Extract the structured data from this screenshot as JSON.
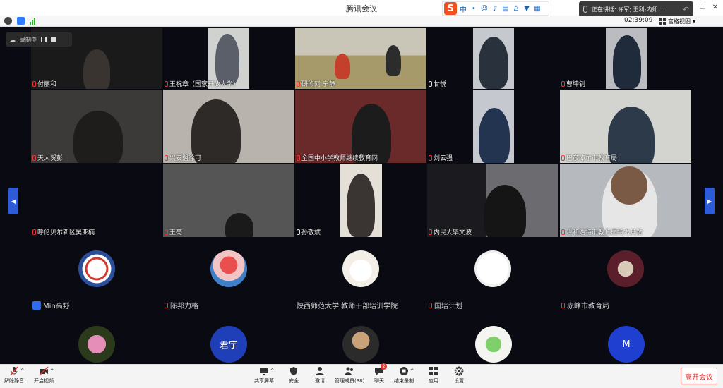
{
  "window": {
    "title": "腾讯会议",
    "speaking_banner": "正在讲话: 许军; 王利-内师..."
  },
  "status": {
    "timer": "02:39:09",
    "view_label": "宫格视图"
  },
  "recording": {
    "label": "录制中"
  },
  "tiles_row1": [
    "付丽和",
    "王祝章（国家开放大学）",
    "研修网 宁静",
    "甘悦",
    "曹坤钊"
  ],
  "tiles_row2": [
    "天人贺彭",
    "兴安盟徐可",
    "全国中小学教师继续教育网",
    "刘云强",
    "巴彦淖尔市教育局"
  ],
  "tiles_row3": [
    "呼伦贝尔新区吴亚楠",
    "王亮",
    "孙敬斌",
    "内民大毕文波",
    "呼和浩特市教育局特木其勒"
  ],
  "avatars_row1": [
    {
      "label": "Min高野"
    },
    {
      "label": "陈邦力格"
    },
    {
      "label": "陕西师范大学 教师干部培训学院"
    },
    {
      "label": "国培计划"
    },
    {
      "label": "赤峰市教育局"
    }
  ],
  "avatars_row2": [
    {
      "initials": ""
    },
    {
      "initials": "君宇"
    },
    {
      "initials": ""
    },
    {
      "initials": ""
    },
    {
      "initials": "M"
    }
  ],
  "toolbar": {
    "mute": "解除静音",
    "video": "开启视频",
    "share": "共享屏幕",
    "security": "安全",
    "invite": "邀请",
    "members": "管理成员(38)",
    "chat": "聊天",
    "chat_badge": "2",
    "record": "结束录制",
    "apps": "应用",
    "settings": "设置",
    "leave": "离开会议"
  },
  "colors": {
    "accent": "#2e5bd8",
    "leave": "#e33333",
    "background": "#0a0a12"
  }
}
